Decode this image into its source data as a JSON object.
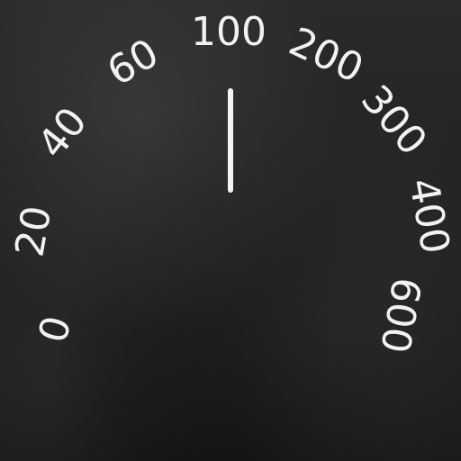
{
  "dial": {
    "scale_labels": [
      "0",
      "20",
      "40",
      "60",
      "100",
      "200",
      "300",
      "400",
      "600"
    ],
    "label_color": "#f2f2f2",
    "pointer_color": "#f5f5f5",
    "pointer_value": "100"
  }
}
